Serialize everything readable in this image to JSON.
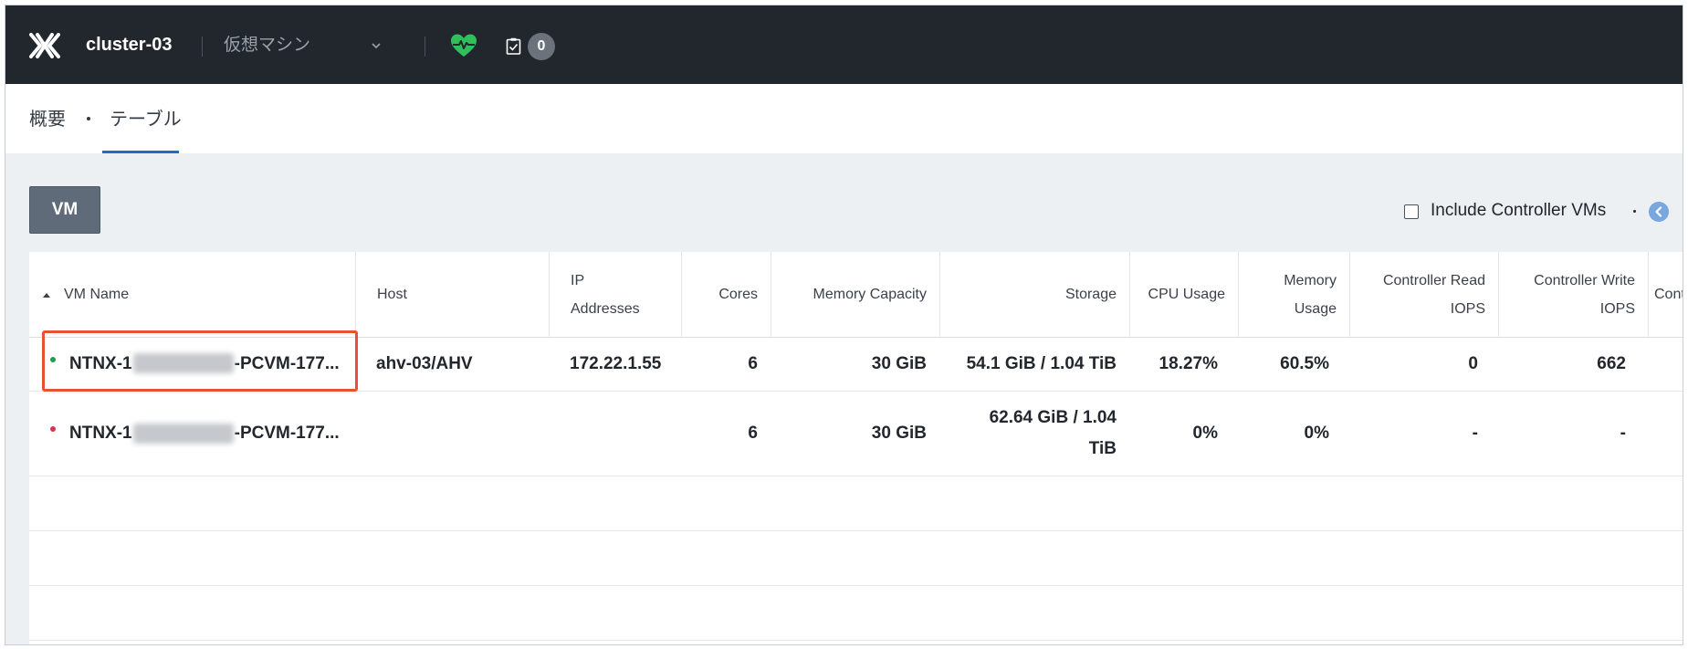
{
  "header": {
    "cluster_name": "cluster-03",
    "view_label": "仮想マシン",
    "task_count": "0"
  },
  "tabs": [
    {
      "label": "概要"
    },
    {
      "label": "テーブル"
    }
  ],
  "toolbar": {
    "vm_button": "VM",
    "include_controller_label": "Include Controller VMs",
    "include_controller_checked": false
  },
  "table": {
    "columns": [
      {
        "label": "VM Name"
      },
      {
        "label": "Host"
      },
      {
        "label": "IP Addresses"
      },
      {
        "label": "Cores"
      },
      {
        "label": "Memory Capacity"
      },
      {
        "label": "Storage"
      },
      {
        "label": "CPU Usage"
      },
      {
        "label": "Memory Usage"
      },
      {
        "label": "Controller Read IOPS"
      },
      {
        "label": "Controller Write IOPS"
      },
      {
        "label": "Cont"
      }
    ],
    "rows": [
      {
        "status": "on",
        "status_color": "#1e9e4a",
        "name_prefix": "NTNX-1",
        "name_suffix": "-PCVM-177...",
        "host": "ahv-03/AHV",
        "ip": "172.22.1.55",
        "cores": "6",
        "memory_capacity": "30 GiB",
        "storage": "54.1 GiB / 1.04 TiB",
        "cpu_usage": "18.27%",
        "memory_usage": "60.5%",
        "controller_read_iops": "0",
        "controller_write_iops": "662"
      },
      {
        "status": "off",
        "status_color": "#d9344f",
        "name_prefix": "NTNX-1",
        "name_suffix": "-PCVM-177...",
        "host": "",
        "ip": "",
        "cores": "6",
        "memory_capacity": "30 GiB",
        "storage": "62.64 GiB / 1.04 TiB",
        "cpu_usage": "0%",
        "memory_usage": "0%",
        "controller_read_iops": "-",
        "controller_write_iops": "-"
      }
    ]
  },
  "colors": {
    "topbar": "#22272e",
    "health": "#2fbf5b",
    "accent": "#1b6ec2",
    "highlight": "#e8532f"
  }
}
